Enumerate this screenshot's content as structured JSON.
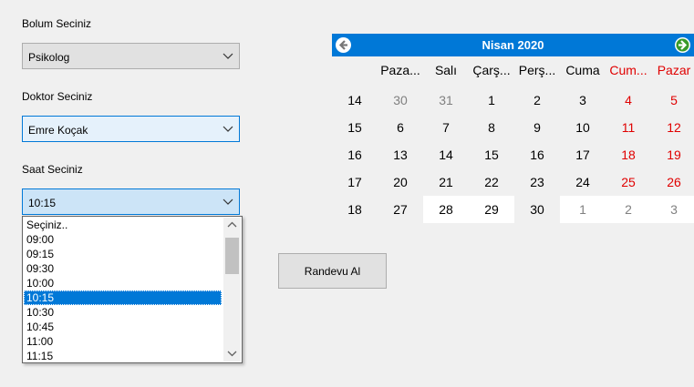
{
  "form": {
    "bolum_label": "Bolum Seciniz",
    "bolum_value": "Psikolog",
    "doktor_label": "Doktor Seciniz",
    "doktor_value": "Emre Koçak",
    "saat_label": "Saat Seciniz",
    "saat_value": "10:15",
    "saat_options": [
      "Seçiniz..",
      "09:00",
      "09:15",
      "09:30",
      "10:00",
      "10:15",
      "10:30",
      "10:45",
      "11:00",
      "11:15"
    ],
    "saat_selected_index": 5,
    "submit_label": "Randevu Al"
  },
  "calendar": {
    "title": "Nisan 2020",
    "weekdays": [
      "Pazartesi",
      "Salı",
      "Çarşamba",
      "Perşembe",
      "Cuma",
      "Cumartesi",
      "Pazar"
    ],
    "weekdays_shown": [
      "Paza...",
      "Salı",
      "Çarş...",
      "Perş...",
      "Cuma",
      "Cum...",
      "Pazar"
    ],
    "week_numbers": [
      "14",
      "15",
      "16",
      "17",
      "18"
    ],
    "weeks": [
      [
        "30",
        "31",
        "1",
        "2",
        "3",
        "4",
        "5"
      ],
      [
        "6",
        "7",
        "8",
        "9",
        "10",
        "11",
        "12"
      ],
      [
        "13",
        "14",
        "15",
        "16",
        "17",
        "18",
        "19"
      ],
      [
        "20",
        "21",
        "22",
        "23",
        "24",
        "25",
        "26"
      ],
      [
        "27",
        "28",
        "29",
        "30",
        "1",
        "2",
        "3"
      ]
    ],
    "colors": {
      "header": "#0078d7",
      "weekend": "#e00000",
      "other_month": "#808080"
    }
  }
}
